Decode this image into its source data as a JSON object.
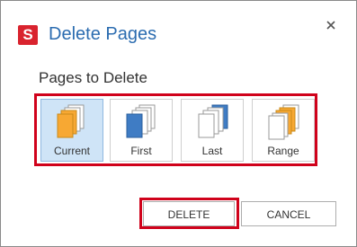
{
  "dialog": {
    "logo_letter": "S",
    "title": "Delete Pages",
    "close_glyph": "×",
    "section_label": "Pages to Delete",
    "options": [
      {
        "label": "Current",
        "icon": "current-pages-icon",
        "selected": true
      },
      {
        "label": "First",
        "icon": "first-page-icon",
        "selected": false
      },
      {
        "label": "Last",
        "icon": "last-page-icon",
        "selected": false
      },
      {
        "label": "Range",
        "icon": "page-range-icon",
        "selected": false
      }
    ],
    "delete_label": "DELETE",
    "cancel_label": "CANCEL"
  },
  "colors": {
    "brand": "#d9232e",
    "title": "#2b6cb0",
    "highlight": "#d0021b",
    "orange_page": "#f7a833",
    "blue_page": "#3f7cc4",
    "selected_bg": "#cfe4f7"
  }
}
